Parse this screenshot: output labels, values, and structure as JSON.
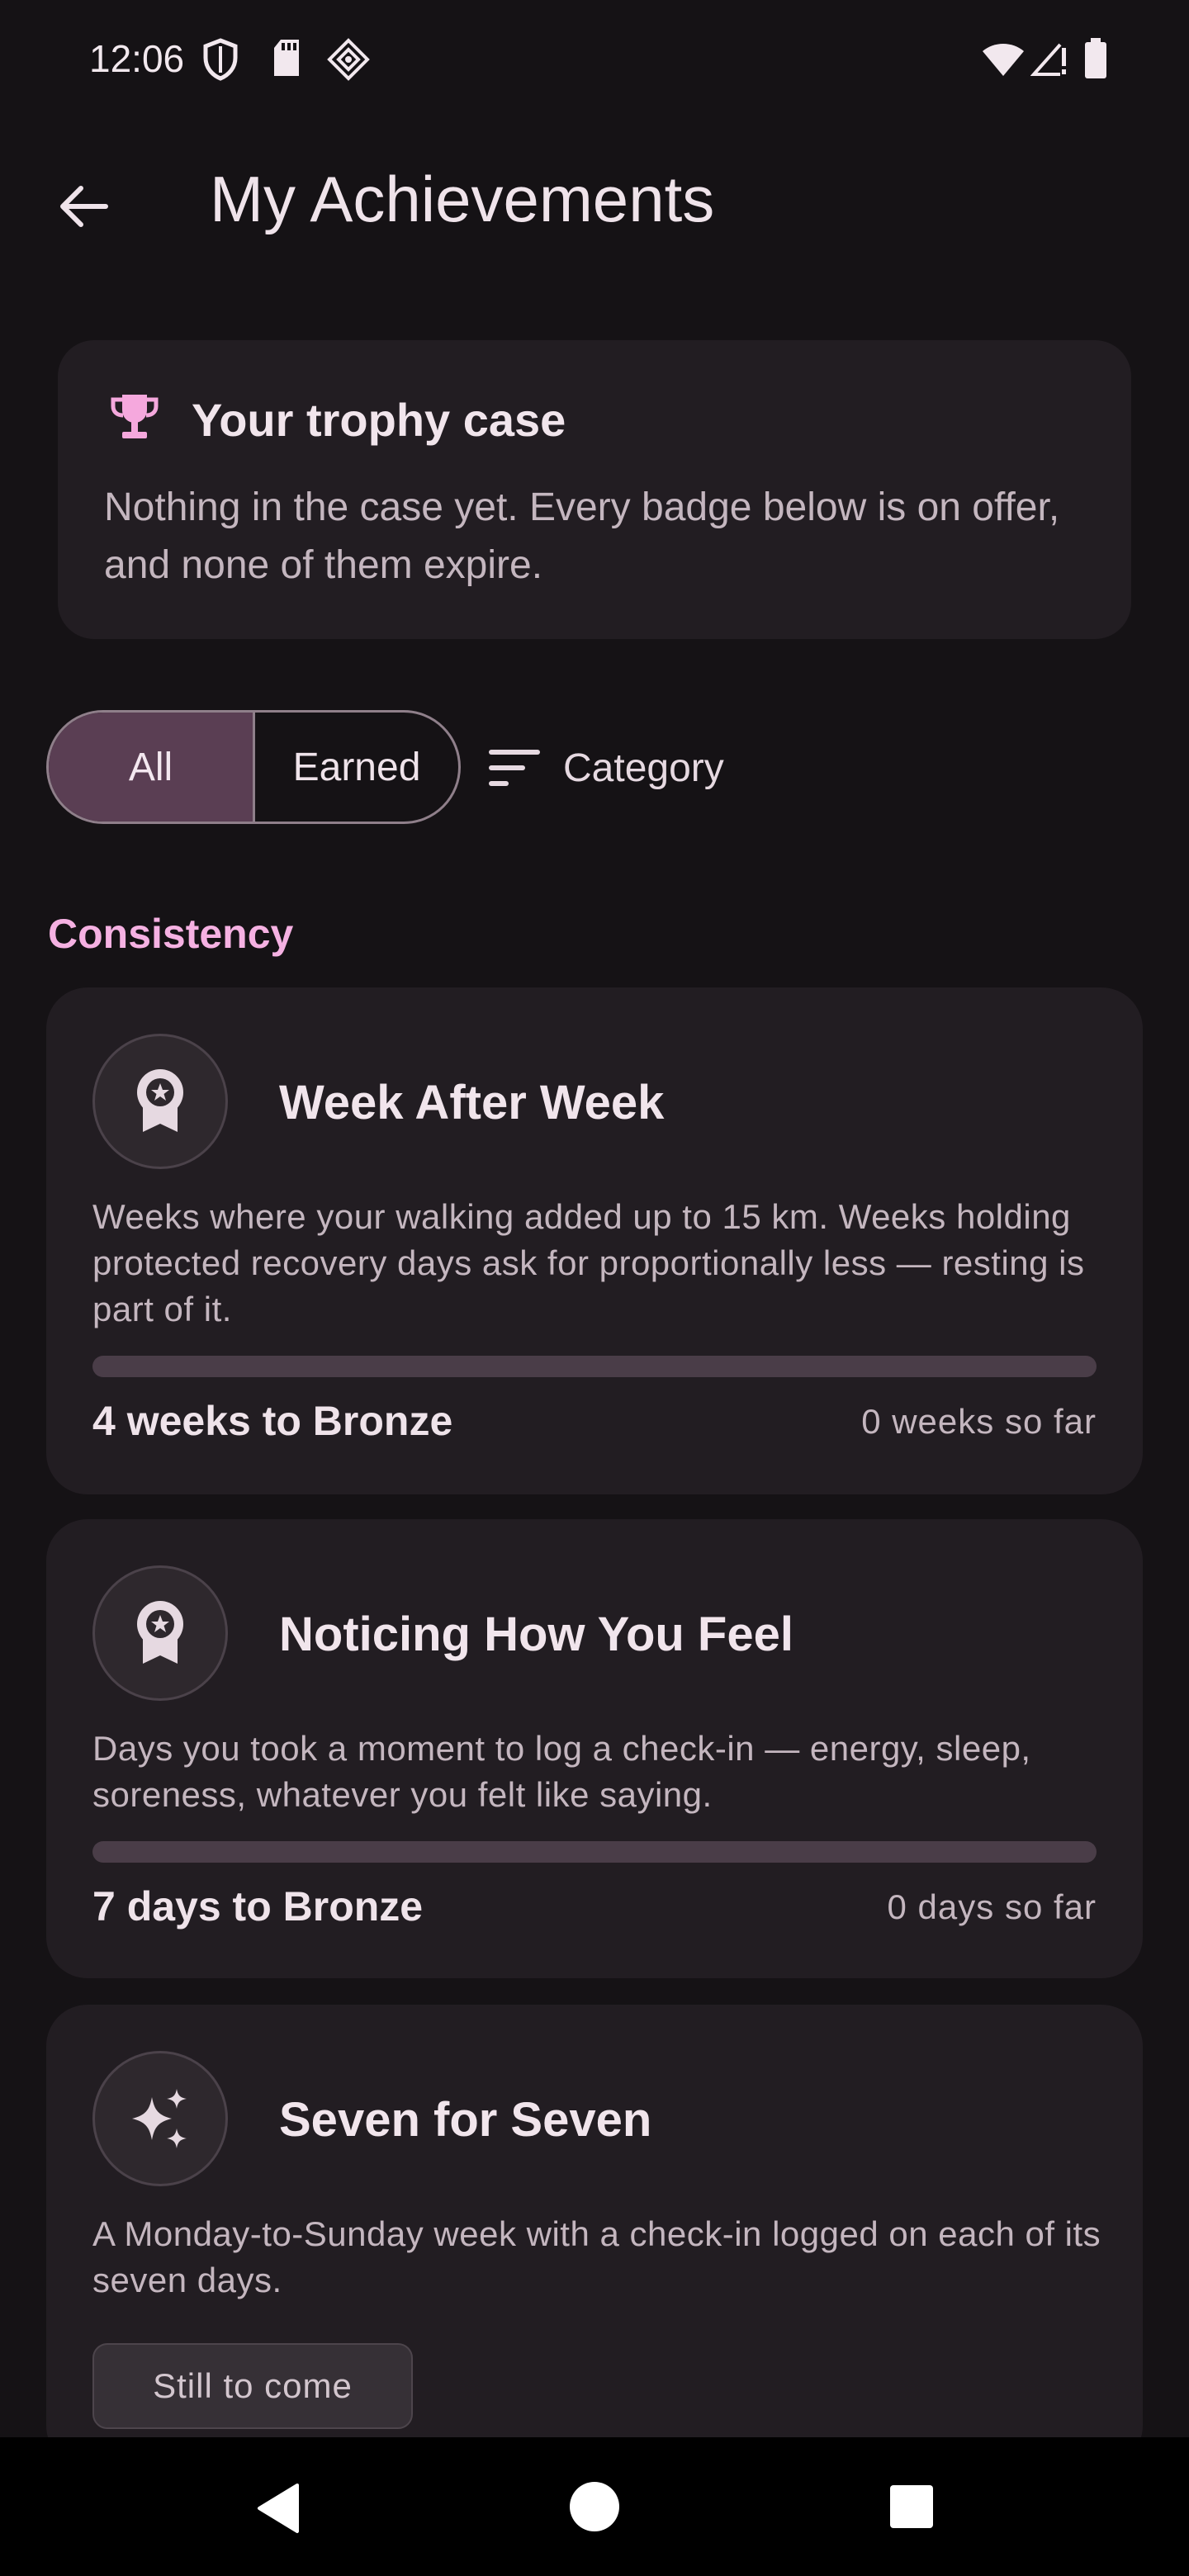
{
  "status_bar": {
    "time": "12:06",
    "left_icons": [
      "shield-icon",
      "sd-card-icon",
      "diamond-app-icon"
    ],
    "right_icons": [
      "wifi-icon",
      "signal-icon",
      "battery-icon"
    ]
  },
  "app_bar": {
    "title": "My Achievements",
    "back_icon": "arrow-back-icon"
  },
  "summary": {
    "icon": "trophy-icon",
    "title": "Your trophy case",
    "text": "Nothing in the case yet. Every badge below is on offer, and none of them expire."
  },
  "filters": {
    "all_label": "All",
    "earned_label": "Earned",
    "category_label": "Category",
    "selected": "All"
  },
  "section": {
    "title": "Consistency"
  },
  "cards": [
    {
      "icon": "award-ribbon-icon",
      "title": "Week After Week",
      "description": "Weeks where your walking added up to 15 km. Weeks holding protected recovery days ask for proportionally less — resting is part of it.",
      "goal": "4 weeks to Bronze",
      "so_far": "0 weeks so far",
      "progress": 0
    },
    {
      "icon": "award-ribbon-icon",
      "title": "Noticing How You Feel",
      "description": "Days you took a moment to log a check-in — energy, sleep, soreness, whatever you felt like saying.",
      "goal": "7 days to Bronze",
      "so_far": "0 days so far",
      "progress": 0
    },
    {
      "icon": "sparkle-icon",
      "title": "Seven for Seven",
      "description": "A Monday-to-Sunday week with a check-in logged on each of its seven days.",
      "status": "Still to come"
    }
  ],
  "colors": {
    "background": "#151215",
    "card": "#221d22",
    "accent": "#f5b1e2",
    "selected_segment": "#5a3e53",
    "progress_track": "#4a3d48"
  },
  "nav_bar": {
    "icons": [
      "back-triangle-icon",
      "home-circle-icon",
      "recents-square-icon"
    ]
  }
}
